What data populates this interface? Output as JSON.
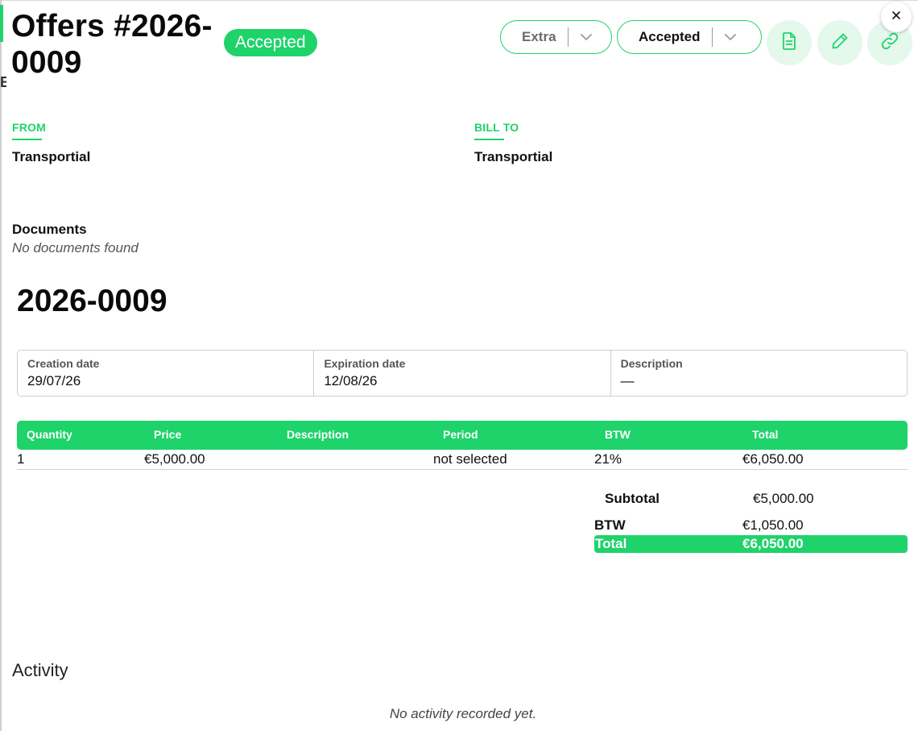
{
  "header": {
    "title": "Offers #2026-0009",
    "status_badge": "Accepted",
    "extra_dropdown_label": "Extra",
    "status_dropdown_label": "Accepted"
  },
  "icons": {
    "document": "document-icon",
    "edit": "pencil-icon",
    "link": "link-icon",
    "close": "close-icon",
    "chevron": "chevron-down-icon"
  },
  "parties": {
    "from_label": "FROM",
    "from_name": "Transportial",
    "bill_to_label": "BILL TO",
    "bill_to_name": "Transportial"
  },
  "documents": {
    "title": "Documents",
    "empty_text": "No documents found"
  },
  "offer_number": "2026-0009",
  "info": {
    "creation_label": "Creation date",
    "creation_value": "29/07/26",
    "expiration_label": "Expiration date",
    "expiration_value": "12/08/26",
    "description_label": "Description",
    "description_value": "—"
  },
  "items": {
    "columns": [
      "Quantity",
      "Price",
      "Description",
      "Period",
      "BTW",
      "Total"
    ],
    "rows": [
      {
        "quantity": "1",
        "price": "€5,000.00",
        "description": "",
        "period": "not selected",
        "btw": "21%",
        "total": "€6,050.00"
      }
    ]
  },
  "totals": {
    "subtotal_label": "Subtotal",
    "subtotal_value": "€5,000.00",
    "btw_label": "BTW",
    "btw_value": "€1,050.00",
    "total_label": "Total",
    "total_value": "€6,050.00"
  },
  "activity": {
    "title": "Activity",
    "empty_text": "No activity recorded yet."
  },
  "colors": {
    "accent": "#1fd36b",
    "accent_light": "#e4f8ec"
  }
}
